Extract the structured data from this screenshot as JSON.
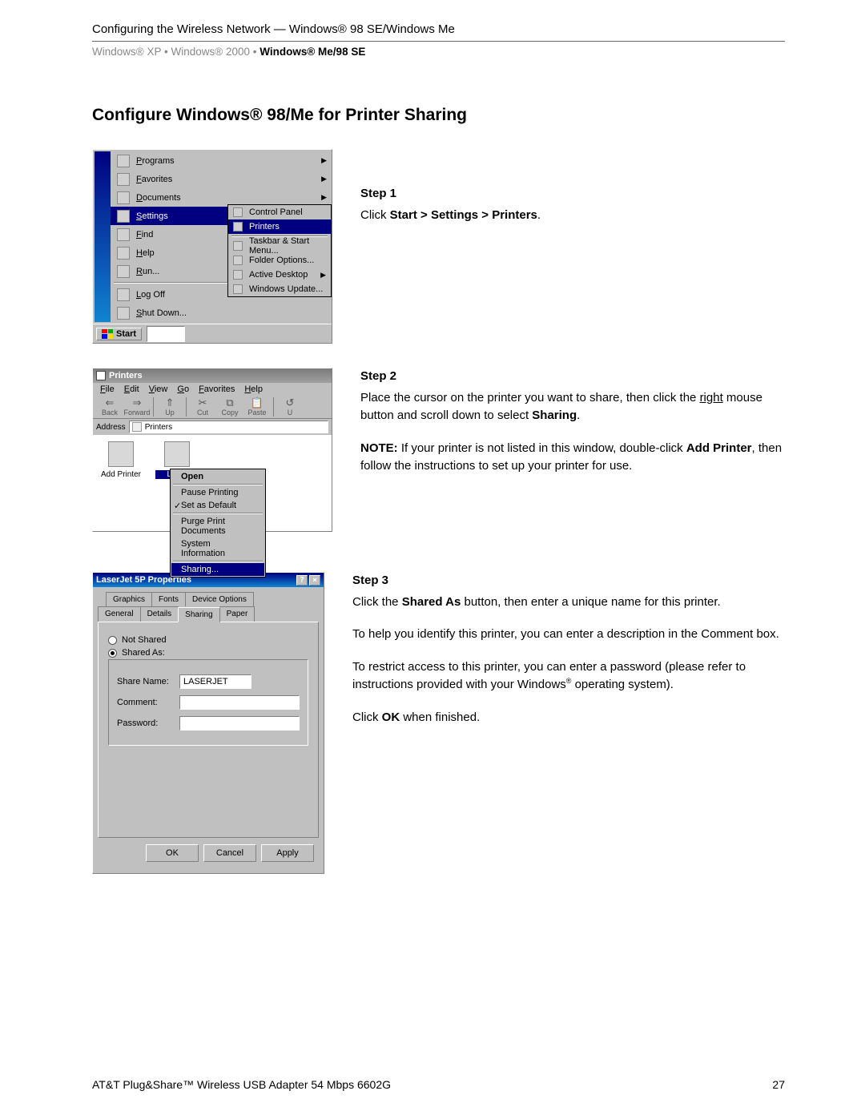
{
  "header": {
    "title": "Configuring the Wireless Network — Windows® 98 SE/Windows Me",
    "crumb_xp": "Windows® XP",
    "crumb_2000": "Windows® 2000",
    "crumb_me98": "Windows® Me/98 SE",
    "sep": " • "
  },
  "section_title": "Configure Windows® 98/Me for Printer Sharing",
  "step1": {
    "title": "Step 1",
    "text_prefix": "Click ",
    "path": "Start > Settings > Printers",
    "text_suffix": "."
  },
  "step2": {
    "title": "Step 2",
    "text": "Place the cursor on the printer you want to share, then click the right mouse button and scroll down to select Sharing.",
    "note_label": "NOTE:",
    "note_text": " If your printer is not listed in this window, double-click Add Printer, then follow the instructions to set up your printer for use."
  },
  "step3": {
    "title": "Step 3",
    "p1": "Click the Shared As button, then enter a unique name for this printer.",
    "p2": "To help you identify this printer, you can enter a description in the Comment box.",
    "p3": "To restrict access to this printer, you can enter a password (please refer to instructions provided with your Windows® operating system).",
    "p4": "Click OK when finished."
  },
  "start_menu": {
    "items": [
      "Programs",
      "Favorites",
      "Documents",
      "Settings",
      "Find",
      "Help",
      "Run...",
      "Log Off",
      "Shut Down..."
    ],
    "selected": "Settings",
    "submenu": [
      "Control Panel",
      "Printers",
      "Taskbar & Start Menu...",
      "Folder Options...",
      "Active Desktop",
      "Windows Update..."
    ],
    "sub_selected": "Printers",
    "start_label": "Start"
  },
  "printers_window": {
    "title": "Printers",
    "menus": [
      "File",
      "Edit",
      "View",
      "Go",
      "Favorites",
      "Help"
    ],
    "toolbar": [
      {
        "glyph": "⇐",
        "label": "Back"
      },
      {
        "glyph": "⇒",
        "label": "Forward"
      },
      {
        "glyph": "⇑",
        "label": "Up"
      },
      {
        "glyph": "✂",
        "label": "Cut"
      },
      {
        "glyph": "⧉",
        "label": "Copy"
      },
      {
        "glyph": "📋",
        "label": "Paste"
      },
      {
        "glyph": "↺",
        "label": "U"
      }
    ],
    "addr_label": "Address",
    "addr_value": "Printers",
    "icons": [
      {
        "label": "Add Printer"
      },
      {
        "label": "LaserJet 5P"
      }
    ],
    "context": [
      "Open",
      "Pause Printing",
      "Set as Default",
      "Purge Print Documents",
      "System Information",
      "Sharing..."
    ],
    "ctx_selected": "Sharing...",
    "ctx_default": "Set as Default"
  },
  "properties_dialog": {
    "title": "LaserJet 5P Properties",
    "tabs_row1": [
      "Graphics",
      "Fonts",
      "Device Options"
    ],
    "tabs_row2": [
      "General",
      "Details",
      "Sharing",
      "Paper"
    ],
    "active_tab": "Sharing",
    "not_shared": "Not Shared",
    "shared_as": "Shared As:",
    "share_name_label": "Share Name:",
    "share_name_value": "LASERJET",
    "comment_label": "Comment:",
    "password_label": "Password:",
    "ok": "OK",
    "cancel": "Cancel",
    "apply": "Apply"
  },
  "footer": {
    "product": "AT&T Plug&Share™ Wireless USB Adapter 54 Mbps 6602G",
    "page": "27"
  }
}
